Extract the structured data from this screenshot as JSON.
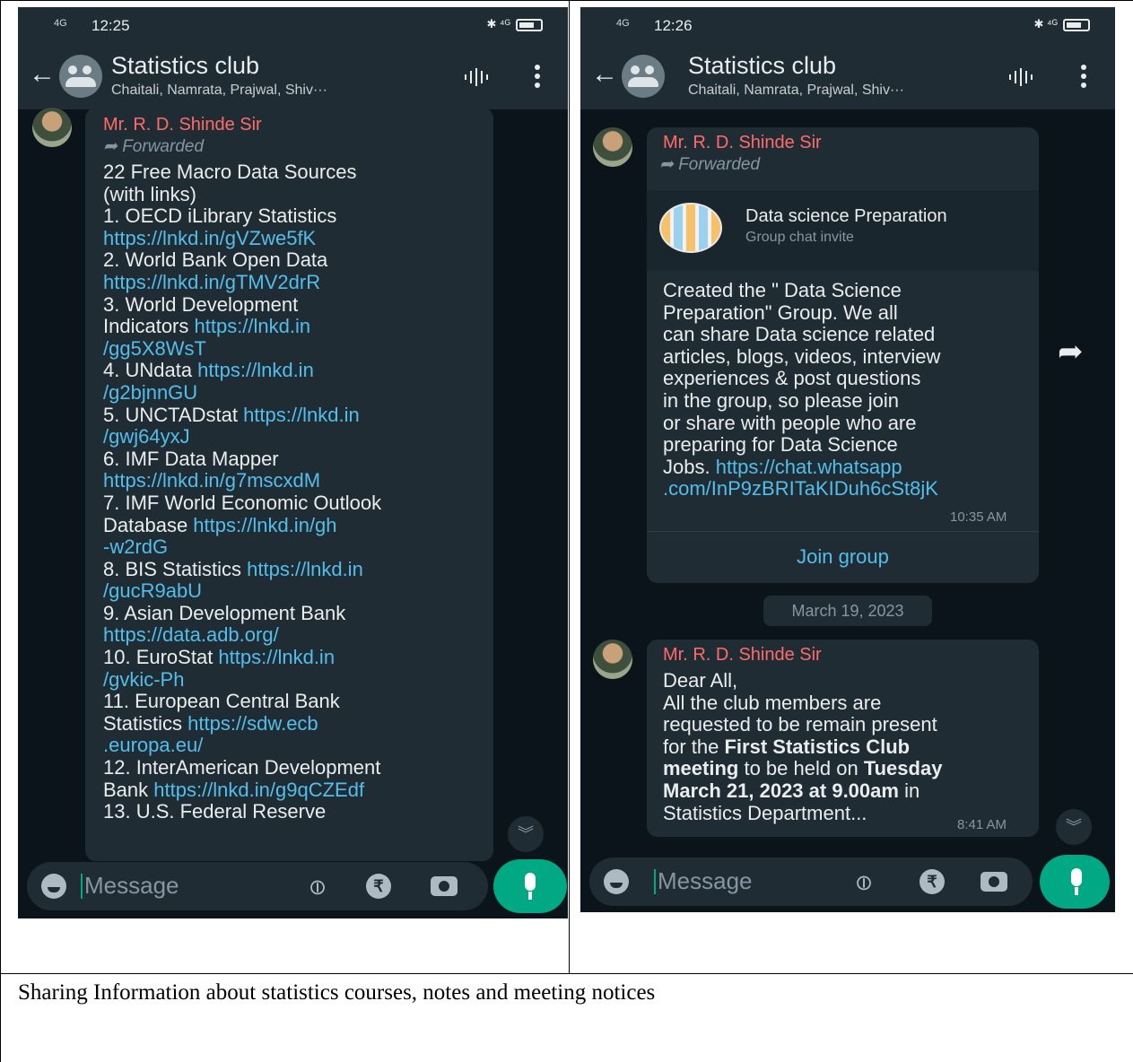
{
  "caption": "Sharing Information about statistics courses, notes and meeting notices",
  "phone_left": {
    "status": {
      "time": "12:25",
      "network": "4G",
      "icons_right": "✱ ⁴ᴳ"
    },
    "header": {
      "title": "Statistics club",
      "subtitle": "Chaitali, Namrata, Prajwal, Shiv···"
    },
    "message": {
      "sender": "Mr. R. D. Shinde Sir",
      "forwarded": "Forwarded",
      "lines": [
        {
          "t": "22 Free Macro Data Sources"
        },
        {
          "t": "(with links)"
        },
        {
          "t": "1. OECD iLibrary Statistics"
        },
        {
          "l": "https://lnkd.in/gVZwe5fK"
        },
        {
          "t": "2. World Bank Open Data"
        },
        {
          "l": "https://lnkd.in/gTMV2drR"
        },
        {
          "t": "3. World Development"
        },
        {
          "t": "Indicators ",
          "l": "https://lnkd.in"
        },
        {
          "l": "/gg5X8WsT"
        },
        {
          "t": "4. UNdata ",
          "l": "https://lnkd.in"
        },
        {
          "l": "/g2bjnnGU"
        },
        {
          "t": "5. UNCTADstat ",
          "l": "https://lnkd.in"
        },
        {
          "l": "/gwj64yxJ"
        },
        {
          "t": "6. IMF Data Mapper"
        },
        {
          "l": "https://lnkd.in/g7mscxdM"
        },
        {
          "t": "7. IMF World Economic Outlook"
        },
        {
          "t": "Database ",
          "l": "https://lnkd.in/gh"
        },
        {
          "l": "-w2rdG"
        },
        {
          "t": "8. BIS Statistics ",
          "l": "https://lnkd.in"
        },
        {
          "l": "/gucR9abU"
        },
        {
          "t": "9. Asian Development Bank"
        },
        {
          "l": "https://data.adb.org/"
        },
        {
          "t": "10. EuroStat ",
          "l": "https://lnkd.in"
        },
        {
          "l": "/gvkic-Ph"
        },
        {
          "t": "11. European Central Bank"
        },
        {
          "t": "Statistics ",
          "l": "https://sdw.ecb"
        },
        {
          "l": ".europa.eu/"
        },
        {
          "t": "12. InterAmerican Development"
        },
        {
          "t": "Bank ",
          "l": "https://lnkd.in/g9qCZEdf"
        },
        {
          "t": "13. U.S. Federal Reserve"
        }
      ]
    },
    "composer": {
      "placeholder": "Message",
      "rupee": "₹"
    }
  },
  "phone_right": {
    "status": {
      "time": "12:26",
      "network": "4G",
      "icons_right": "✱ ⁴ᴳ"
    },
    "header": {
      "title": "Statistics club",
      "subtitle": "Chaitali, Namrata, Prajwal, Shiv···"
    },
    "message1": {
      "sender": "Mr. R. D. Shinde Sir",
      "forwarded": "Forwarded",
      "invite_title": "Data science Preparation",
      "invite_sub": "Group chat invite",
      "lines": [
        {
          "t": "Created the \" Data Science"
        },
        {
          "t": "Preparation\" Group. We all"
        },
        {
          "t": "can share Data science related"
        },
        {
          "t": "articles, blogs, videos, interview"
        },
        {
          "t": "experiences & post questions"
        },
        {
          "t": "in the group, so please join"
        },
        {
          "t": "or share with people who are"
        },
        {
          "t": "preparing for Data Science"
        },
        {
          "t": "Jobs. ",
          "l": "https://chat.whatsapp"
        },
        {
          "l": ".com/InP9zBRITaKIDuh6cSt8jK"
        }
      ],
      "time": "10:35 AM",
      "join_label": "Join group"
    },
    "date_chip": "March 19, 2023",
    "message2": {
      "sender": "Mr. R. D. Shinde Sir",
      "lines": [
        {
          "t": "Dear All,"
        },
        {
          "t": "All the club members are"
        },
        {
          "t": "requested to be remain present"
        },
        {
          "t": "for the ",
          "b": "First Statistics Club"
        },
        {
          "b": "meeting",
          "t2": " to be held on ",
          "b2": "Tuesday"
        },
        {
          "b": "March 21, 2023 at 9.00am",
          "t2": " in"
        },
        {
          "t": "Statistics Department..."
        }
      ],
      "time": "8:41 AM"
    },
    "composer": {
      "placeholder": "Message",
      "rupee": "₹"
    }
  }
}
